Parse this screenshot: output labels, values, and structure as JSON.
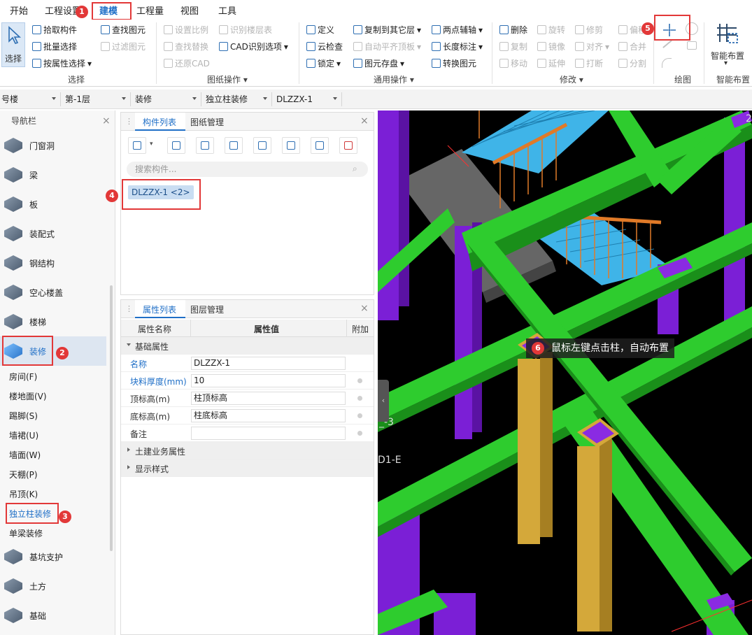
{
  "menubar": {
    "items": [
      "开始",
      "工程设置",
      "建模",
      "工程量",
      "视图",
      "工具"
    ],
    "active_index": 2
  },
  "ribbon": {
    "select_btn": "选择",
    "select_group": [
      "拾取构件",
      "批量选择",
      "按属性选择"
    ],
    "find_group": [
      "查找图元",
      "过滤图元"
    ],
    "select_title": "选择",
    "drawing_ops": [
      "设置比例",
      "识别楼层表",
      "查找替换",
      "CAD识别选项",
      "还原CAD"
    ],
    "drawing_title": "图纸操作",
    "common_ops": [
      "定义",
      "复制到其它层",
      "两点辅轴",
      "云检查",
      "自动平齐顶板",
      "长度标注",
      "锁定",
      "图元存盘",
      "转换图元"
    ],
    "common_title": "通用操作",
    "modify_ops": [
      "删除",
      "旋转",
      "修剪",
      "偏移",
      "复制",
      "镜像",
      "对齐",
      "合并",
      "移动",
      "延伸",
      "打断",
      "分割"
    ],
    "modify_title": "修改",
    "draw_title": "绘图",
    "smart_btn": "智能布置",
    "smart_title": "智能布置"
  },
  "selectors": [
    "号楼",
    "第-1层",
    "装修",
    "独立柱装修",
    "DLZZX-1"
  ],
  "nav": {
    "title": "导航栏",
    "items": [
      "门窗洞",
      "梁",
      "板",
      "装配式",
      "钢结构",
      "空心楼盖",
      "楼梯",
      "装修"
    ],
    "sub_items": [
      "房间(F)",
      "楼地面(V)",
      "踢脚(S)",
      "墙裙(U)",
      "墙面(W)",
      "天棚(P)",
      "吊顶(K)",
      "独立柱装修",
      "单梁装修"
    ],
    "bottom_items": [
      "基坑支护",
      "土方",
      "基础"
    ]
  },
  "component_list": {
    "tabs": [
      "构件列表",
      "图纸管理"
    ],
    "search_placeholder": "搜索构件...",
    "item": "DLZZX-1 <2>"
  },
  "property_list": {
    "tabs": [
      "属性列表",
      "图层管理"
    ],
    "headers": [
      "属性名称",
      "属性值",
      "附加"
    ],
    "group1": "基础属性",
    "rows": [
      {
        "name": "名称",
        "value": "DLZZX-1"
      },
      {
        "name": "块料厚度(mm)",
        "value": "10"
      },
      {
        "name": "顶标高(m)",
        "value": "柱顶标高"
      },
      {
        "name": "底标高(m)",
        "value": "柱底标高"
      },
      {
        "name": "备注",
        "value": ""
      }
    ],
    "group2": "土建业务属性",
    "group3": "显示样式"
  },
  "viewport": {
    "tip": "鼠标左键点击柱，自动布置",
    "axis_labels": [
      "_-3",
      "D1-E",
      "2"
    ]
  },
  "annotations": [
    "1",
    "2",
    "3",
    "4",
    "5",
    "6"
  ],
  "colors": {
    "accent": "#1f6fc7",
    "beam": "#2ecc2e",
    "column": "#7b1fd6",
    "selected_column": "#d4a83a",
    "stairs": "#3fb4e8",
    "highlight": "#e23838"
  }
}
